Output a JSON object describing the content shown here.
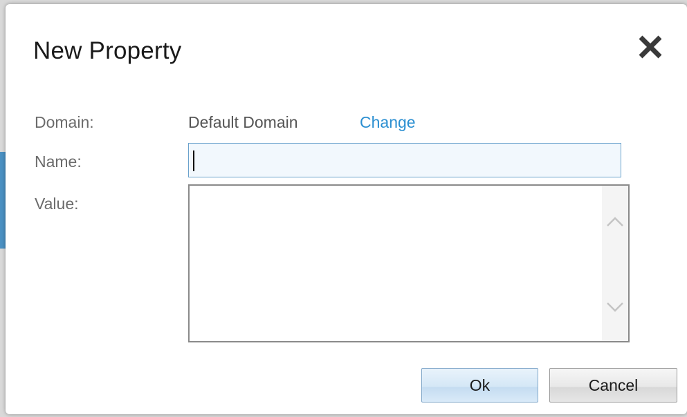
{
  "dialog": {
    "title": "New Property",
    "close_icon": "close-icon"
  },
  "form": {
    "domain_label": "Domain:",
    "domain_value": "Default Domain",
    "change_link": "Change",
    "name_label": "Name:",
    "name_value": "",
    "value_label": "Value:",
    "value_text": ""
  },
  "buttons": {
    "ok_label": "Ok",
    "cancel_label": "Cancel"
  },
  "colors": {
    "link": "#2b8fd1",
    "input_border": "#6aa2cc",
    "label": "#6b6b6b"
  },
  "icons": {
    "scroll_up": "chevron-up-icon",
    "scroll_down": "chevron-down-icon"
  }
}
